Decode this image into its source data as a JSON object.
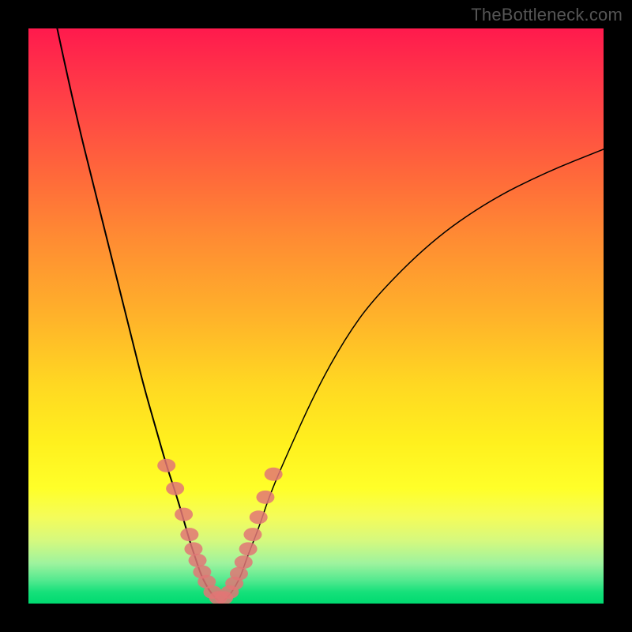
{
  "watermark": "TheBottleneck.com",
  "colors": {
    "frame": "#000000",
    "curve": "#000000",
    "bead": "#e27676",
    "gradient_top": "#ff1a4d",
    "gradient_bottom": "#00da70"
  },
  "chart_data": {
    "type": "line",
    "title": "",
    "xlabel": "",
    "ylabel": "",
    "xlim": [
      0,
      100
    ],
    "ylim": [
      0,
      100
    ],
    "grid": false,
    "legend": false,
    "series": [
      {
        "name": "curve-left",
        "x": [
          5,
          8,
          12,
          15,
          18,
          20,
          22,
          24,
          26,
          28,
          29,
          30,
          31,
          32,
          33
        ],
        "y": [
          100,
          86,
          70,
          58,
          46,
          38,
          31,
          24,
          18,
          11,
          8,
          5,
          3,
          1.5,
          0.5
        ]
      },
      {
        "name": "curve-right",
        "x": [
          34,
          35,
          36,
          37,
          38,
          40,
          42,
          45,
          50,
          55,
          60,
          70,
          80,
          90,
          100
        ],
        "y": [
          0.5,
          1.5,
          3,
          5,
          8,
          13,
          19,
          26,
          37,
          46,
          53,
          63,
          70,
          75,
          79
        ]
      }
    ],
    "bead_markers": {
      "name": "beads",
      "x": [
        24,
        25.5,
        27,
        28,
        28.7,
        29.4,
        30.2,
        31,
        32,
        33,
        34,
        35,
        35.8,
        36.6,
        37.4,
        38.2,
        39,
        40,
        41.2,
        42.6
      ],
      "y": [
        24,
        20,
        15.5,
        12,
        9.5,
        7.5,
        5.5,
        3.8,
        2,
        1,
        1,
        2,
        3.5,
        5.2,
        7.2,
        9.5,
        12,
        15,
        18.5,
        22.5
      ]
    }
  }
}
